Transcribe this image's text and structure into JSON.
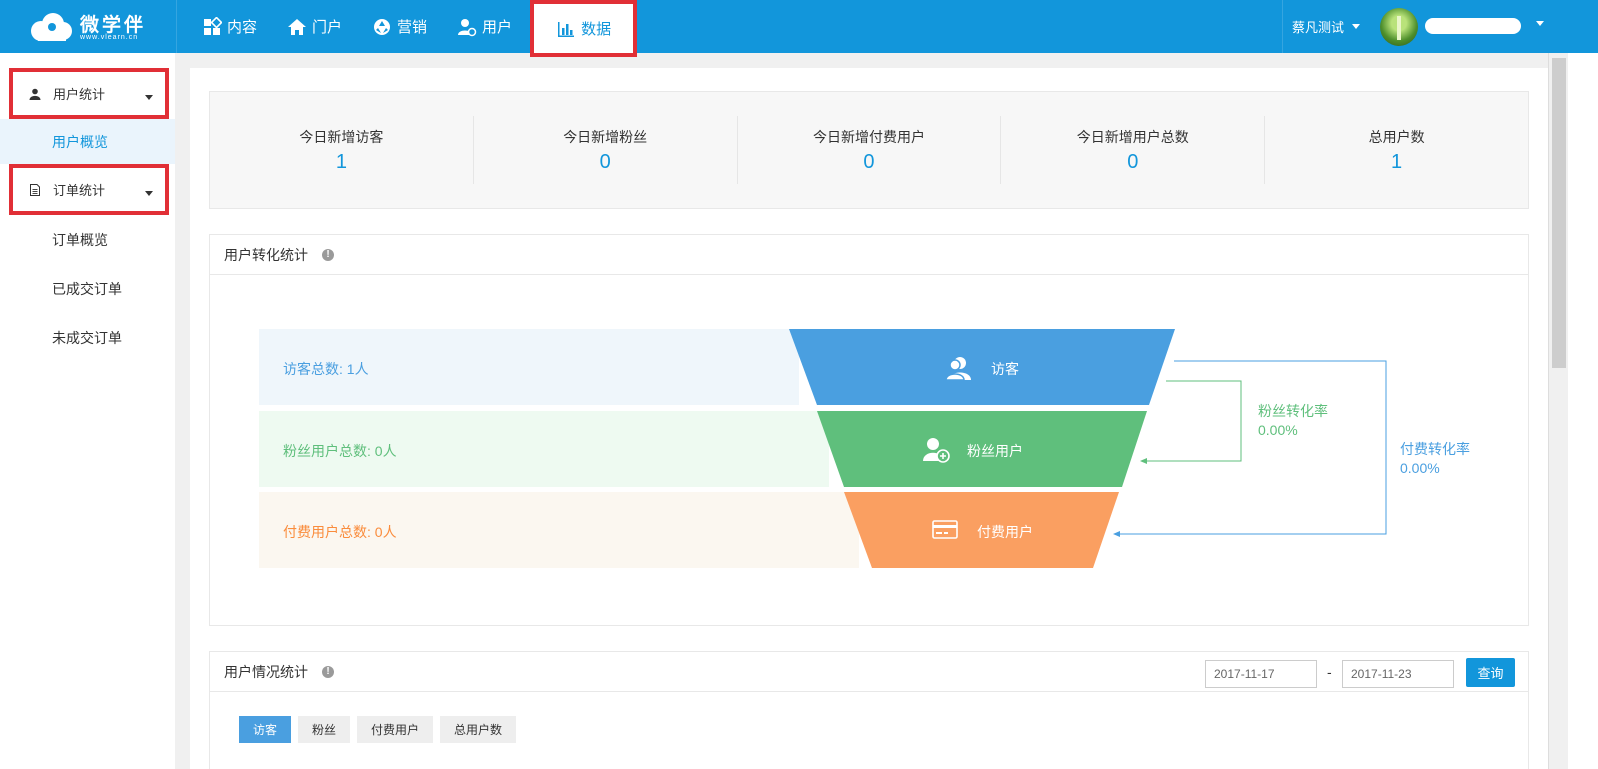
{
  "brand": {
    "name": "微学伴",
    "url": "www.vlearn.cn"
  },
  "nav": [
    {
      "label": "内容",
      "icon": "grid-icon"
    },
    {
      "label": "门户",
      "icon": "home-icon"
    },
    {
      "label": "营销",
      "icon": "aperture-icon"
    },
    {
      "label": "用户",
      "icon": "user-gear-icon"
    },
    {
      "label": "数据",
      "icon": "bar-chart-icon",
      "active": true
    }
  ],
  "header": {
    "tenant": "蔡凡测试"
  },
  "sidebar": {
    "groups": [
      {
        "label": "用户统计",
        "icon": "user-icon",
        "items": [
          {
            "label": "用户概览",
            "active": true
          }
        ]
      },
      {
        "label": "订单统计",
        "icon": "document-icon",
        "items": [
          {
            "label": "订单概览"
          },
          {
            "label": "已成交订单"
          },
          {
            "label": "未成交订单"
          }
        ]
      }
    ]
  },
  "stats": [
    {
      "label": "今日新增访客",
      "value": "1"
    },
    {
      "label": "今日新增粉丝",
      "value": "0"
    },
    {
      "label": "今日新增付费用户",
      "value": "0"
    },
    {
      "label": "今日新增用户总数",
      "value": "0"
    },
    {
      "label": "总用户数",
      "value": "1"
    }
  ],
  "conversion": {
    "title": "用户转化统计",
    "info": "!",
    "levels": [
      {
        "summary": "访客总数: 1人",
        "label": "访客",
        "icon": "users-icon",
        "color": "#4a9fe0",
        "bg": "#eff6fb",
        "text": "#4a9fe0"
      },
      {
        "summary": "粉丝用户总数: 0人",
        "label": "粉丝用户",
        "icon": "user-plus-icon",
        "color": "#5fbf7c",
        "bg": "#eefaf1",
        "text": "#5fbf7c"
      },
      {
        "summary": "付费用户总数: 0人",
        "label": "付费用户",
        "icon": "card-icon",
        "color": "#fa9f61",
        "bg": "#fbf7f0",
        "text": "#fa8c3c"
      }
    ],
    "fan_rate": {
      "label": "粉丝转化率",
      "value": "0.00%",
      "color": "#5fbf7c"
    },
    "pay_rate": {
      "label": "付费转化率",
      "value": "0.00%",
      "color": "#4a9fe0"
    }
  },
  "user_stats": {
    "title": "用户情况统计",
    "info": "!",
    "start_date": "2017-11-17",
    "separator": "-",
    "end_date": "2017-11-23",
    "query_label": "查询",
    "tabs": [
      {
        "label": "访客",
        "active": true
      },
      {
        "label": "粉丝"
      },
      {
        "label": "付费用户"
      },
      {
        "label": "总用户数"
      }
    ]
  }
}
